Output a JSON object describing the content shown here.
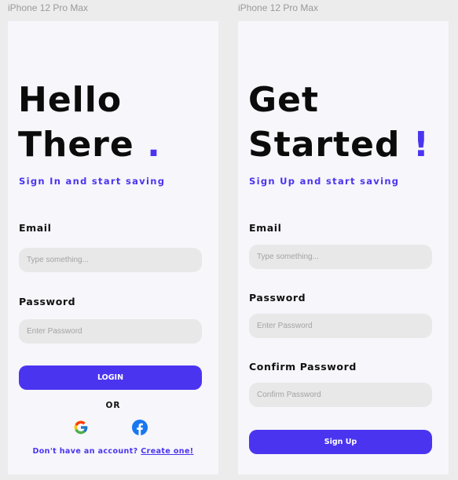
{
  "frames": {
    "signin_label": "iPhone 12 Pro Max",
    "signup_label": "iPhone 12 Pro Max"
  },
  "colors": {
    "accent": "#4b34f0",
    "field_bg": "#e8e8e8",
    "screen_bg": "#f6f6fb"
  },
  "signin": {
    "title_line1": "Hello",
    "title_line2": "There",
    "title_mark": ".",
    "subtitle": "Sign In and start saving",
    "email_label": "Email",
    "email_placeholder": "Type something...",
    "password_label": "Password",
    "password_placeholder": "Enter Password",
    "login_button": "LOGIN",
    "or_text": "OR",
    "social": [
      {
        "icon": "google-icon"
      },
      {
        "icon": "facebook-icon"
      }
    ],
    "footer_text": "Don't have an account?",
    "footer_link": "Create one!"
  },
  "signup": {
    "title_line1": "Get",
    "title_line2": "Started",
    "title_mark": "!",
    "subtitle": "Sign Up and start saving",
    "email_label": "Email",
    "email_placeholder": "Type something...",
    "password_label": "Password",
    "password_placeholder": "Enter Password",
    "confirm_label": "Confirm Password",
    "confirm_placeholder": "Confirm Password",
    "signup_button": "Sign Up"
  }
}
